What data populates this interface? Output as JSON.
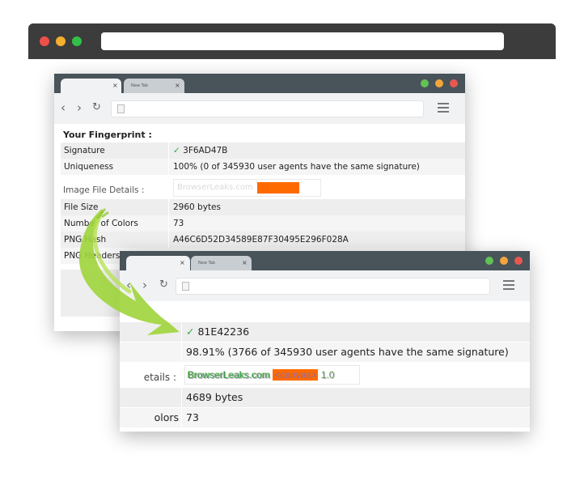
{
  "colors": {
    "outer_bar": "#3c3c3c",
    "tabstrip": "#48535a",
    "dot_red": "#ee5048",
    "dot_yellow": "#f4b02c",
    "dot_green": "#33c048",
    "win_dot_green": "#62c254",
    "win_dot_orange": "#f3a53c",
    "win_dot_red": "#e9584f",
    "canvas_orange": "#ff6a00",
    "check_green": "#2ea84a",
    "arrow_green": "#9fd43a"
  },
  "icons": {
    "back": "chevron-left-icon",
    "forward": "chevron-right-icon",
    "reload": "reload-icon",
    "page": "page-icon",
    "menu": "hamburger-icon",
    "check": "checkmark-icon",
    "arrow": "curved-arrow-icon"
  },
  "nav": {
    "back": "‹",
    "forward": "›",
    "reload": "↻"
  },
  "back_window": {
    "tabs": [
      {
        "label": "",
        "close": "×"
      },
      {
        "label": "New Tab",
        "close": "×"
      }
    ],
    "title": "Your Fingerprint :",
    "rows": [
      {
        "key": "Signature",
        "check": "✓",
        "value": "3F6AD47B"
      },
      {
        "key": "Uniqueness",
        "value": "100% (0 of 345930 user agents have the same signature)"
      }
    ],
    "section": "Image File Details :",
    "canvas_text": "BrowserLeaks.com",
    "file_rows": [
      {
        "key": "File Size",
        "value": "2960 bytes"
      },
      {
        "key": "Number of Colors",
        "value": "73"
      },
      {
        "key": "PNG Hash",
        "value": "A46C6D52D34589E87F30495E296F028A"
      },
      {
        "key": "PNG Headers",
        "value": ""
      }
    ]
  },
  "front_window": {
    "tabs": [
      {
        "label": "",
        "close": "×"
      },
      {
        "label": "New Tab",
        "close": "×"
      }
    ],
    "rows": [
      {
        "key": "",
        "check": "✓",
        "value": "81E42236"
      },
      {
        "key": "",
        "value": "98.91% (3766 of 345930 user agents have the same signature)"
      }
    ],
    "section": "etails :",
    "canvas": {
      "site": "BrowserLeaks.com",
      "tag": "<canvas>",
      "version": "1.0"
    },
    "file_rows": [
      {
        "key": "",
        "value": "4689 bytes"
      },
      {
        "key": "olors",
        "value": "73"
      }
    ]
  }
}
